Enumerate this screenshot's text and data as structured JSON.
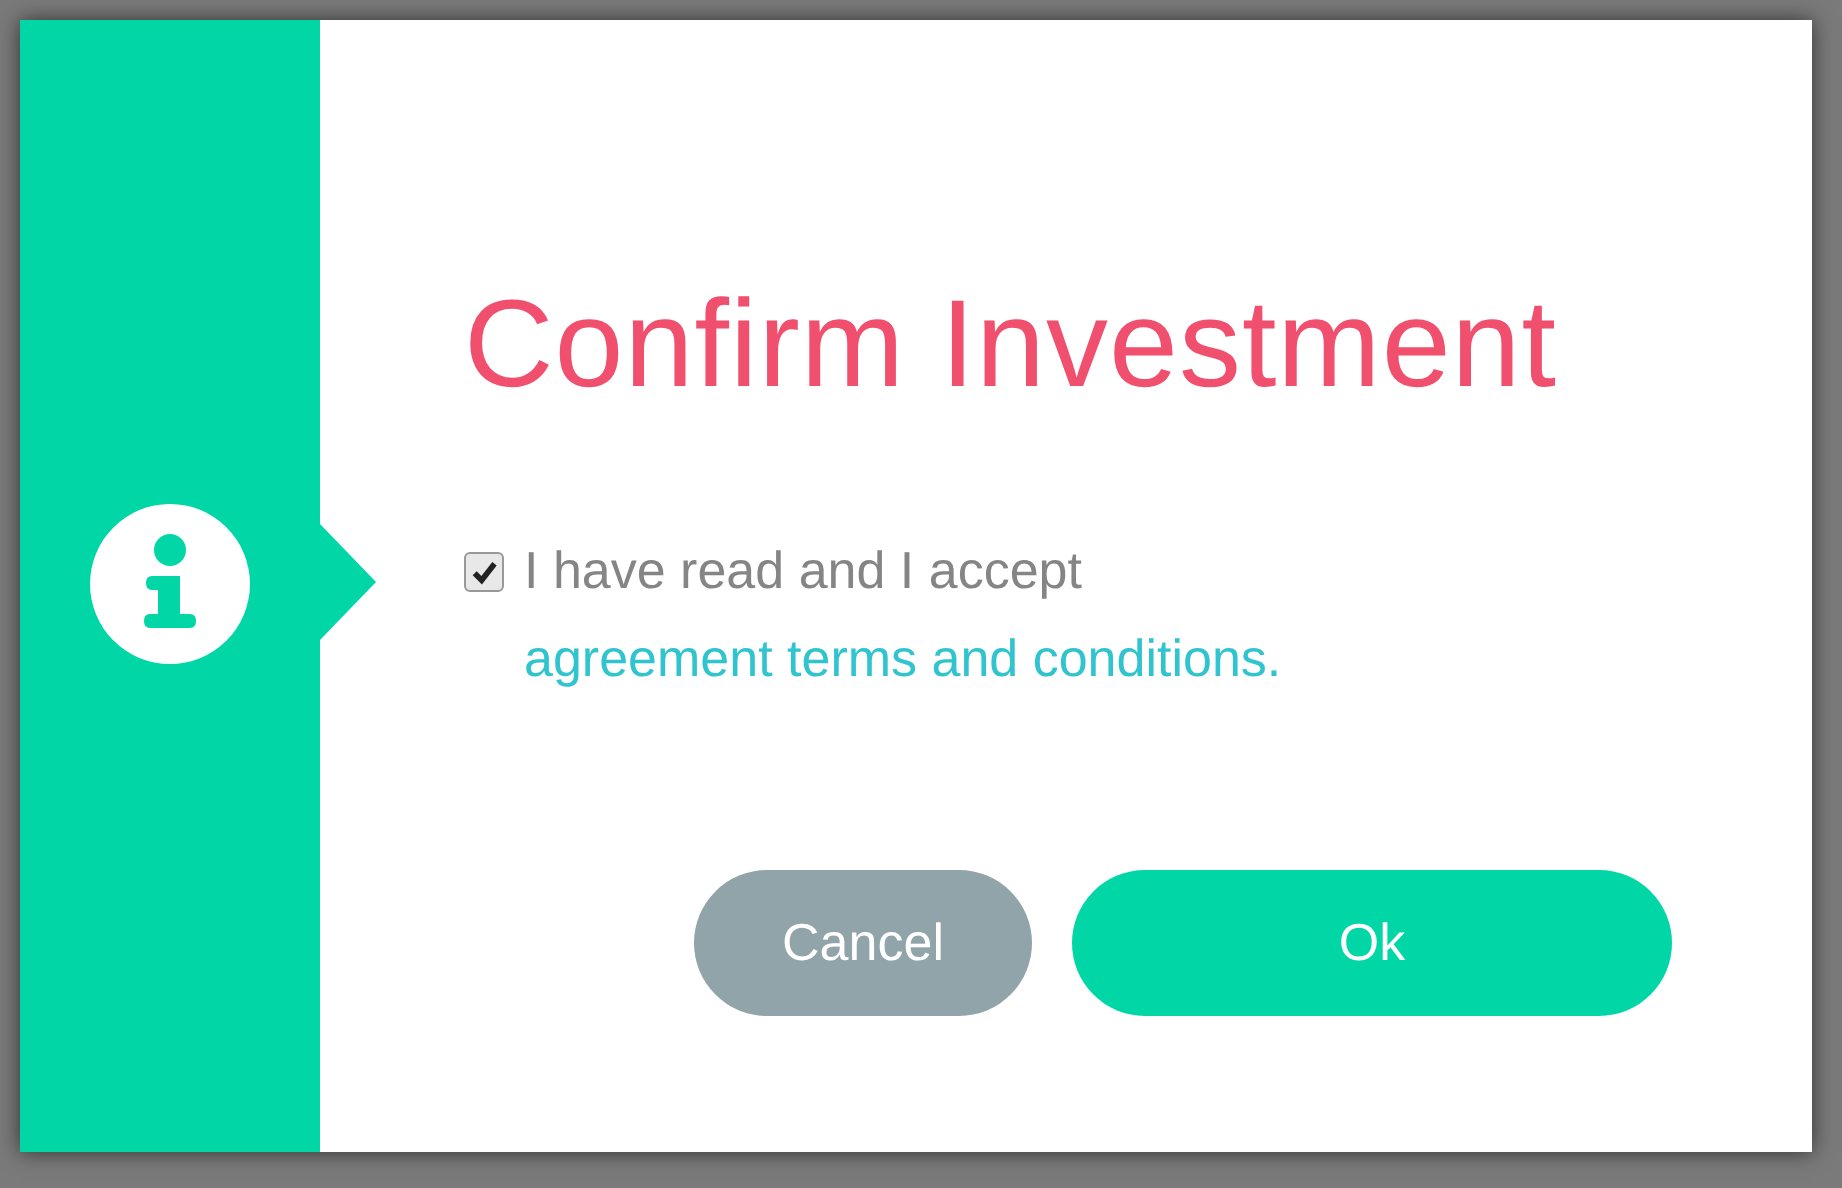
{
  "dialog": {
    "title": "Confirm Investment",
    "consent": {
      "checked": true,
      "text": "I have read and I accept ",
      "link": "agreement terms and conditions."
    },
    "buttons": [
      {
        "label": "Cancel",
        "kind": "secondary"
      },
      {
        "label": "Ok",
        "kind": "primary"
      }
    ]
  }
}
